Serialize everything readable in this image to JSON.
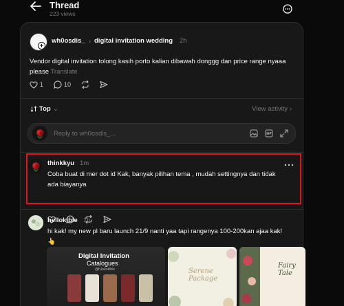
{
  "header": {
    "title": "Thread",
    "views": "223 views"
  },
  "post": {
    "author": "wh0osdis_",
    "separator": "›",
    "topic": "digital invitation wedding",
    "time": "2h",
    "text": "Vendor digital invitation tolong kasih porto kalian dibawah donggg dan price range nyaaa please",
    "translate_label": "Translate",
    "likes": "1",
    "comments": "10"
  },
  "sort": {
    "label": "Top",
    "caret": "⌄",
    "view_activity": "View activity ›"
  },
  "reply": {
    "placeholder": "Reply to wh0osdis_..."
  },
  "comments": [
    {
      "author": "thinkkyu",
      "time": "1m",
      "text": "Coba buat di mer dot id Kak, banyak pilihan tema , mudah settingnya dan tidak ada biayanya"
    },
    {
      "author": "hellokible",
      "time": "1h",
      "text": "hi kak! my new pl baru launch 21/9 nanti yaa tapi rangenya 100-200kan ajaa kak! 👆",
      "attachments": [
        {
          "title": "Digital Invitation",
          "subtitle": "Catalogues",
          "small": "@h1ekoklble"
        },
        {
          "title": "Serene Package"
        },
        {
          "title": "Fairy Tale"
        }
      ]
    }
  ],
  "colors": {
    "background": "#0a0a0a",
    "card": "#181818",
    "highlight": "#e3141b",
    "muted": "#777777"
  }
}
